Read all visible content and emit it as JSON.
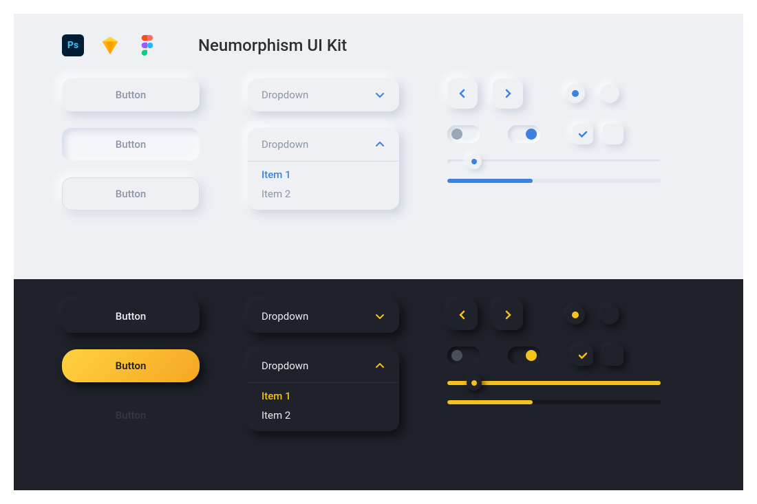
{
  "header": {
    "title": "Neumorphism UI Kit",
    "apps": {
      "ps": "Ps",
      "sketch": "sketch-icon",
      "figma": "figma-icon"
    }
  },
  "light": {
    "accent": "#3b82e0",
    "buttons": [
      "Button",
      "Button",
      "Button"
    ],
    "dropdown_closed": "Dropdown",
    "dropdown_open": {
      "label": "Dropdown",
      "items": [
        "Item 1",
        "Item 2"
      ]
    },
    "radio": {
      "selected": true
    },
    "checkbox": {
      "checked": true
    },
    "slider_value": 12,
    "progress_value": 40
  },
  "dark": {
    "accent": "#f5c11b",
    "buttons": [
      "Button",
      "Button",
      "Button"
    ],
    "dropdown_closed": "Dropdown",
    "dropdown_open": {
      "label": "Dropdown",
      "items": [
        "Item 1",
        "Item 2"
      ]
    },
    "radio": {
      "selected": true
    },
    "checkbox": {
      "checked": true
    },
    "slider_value": 12,
    "progress_value": 40
  }
}
